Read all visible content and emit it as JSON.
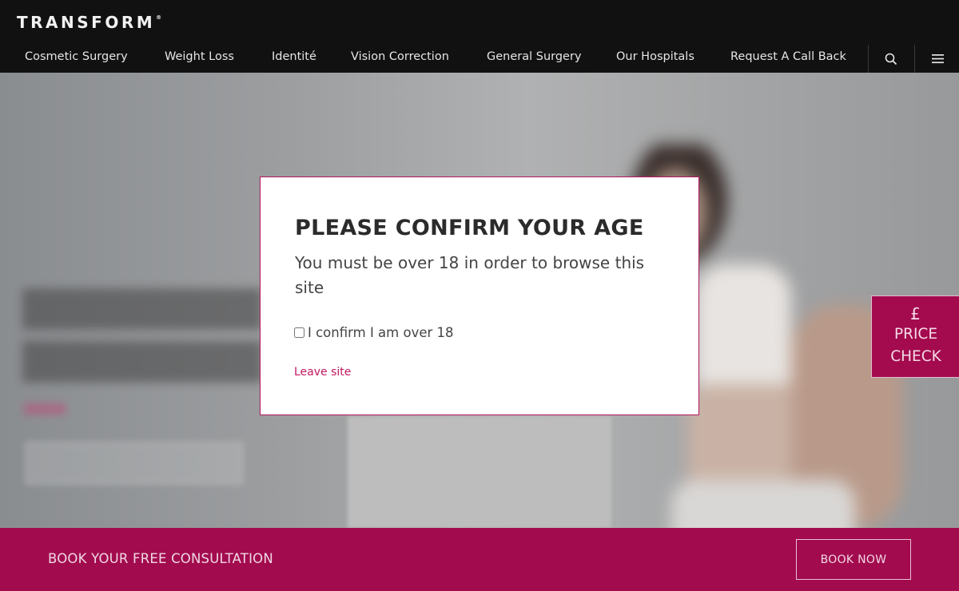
{
  "header": {
    "logo": "TRANSFORM",
    "logo_mark": "®",
    "nav": [
      {
        "label": "Cosmetic Surgery"
      },
      {
        "label": "Weight Loss"
      },
      {
        "label": "Identité"
      },
      {
        "label": "Vision Correction"
      },
      {
        "label": "General Surgery"
      },
      {
        "label": "Our Hospitals"
      },
      {
        "label": "Request A Call Back"
      }
    ],
    "search_icon": "search-icon",
    "menu_icon": "hamburger-menu-icon"
  },
  "modal": {
    "title": "PLEASE CONFIRM YOUR AGE",
    "text": "You must be over 18 in order to browse this site",
    "checkbox_label": "I confirm I am over 18",
    "checkbox_checked": false,
    "leave_link": "Leave site"
  },
  "price_check": {
    "symbol": "£",
    "line1": "PRICE",
    "line2": "CHECK"
  },
  "footer": {
    "text": "BOOK YOUR FREE CONSULTATION",
    "button": "BOOK NOW"
  },
  "colors": {
    "header_bg": "#111111",
    "brand_magenta": "#a30b4f",
    "link_pink": "#c1185f"
  }
}
